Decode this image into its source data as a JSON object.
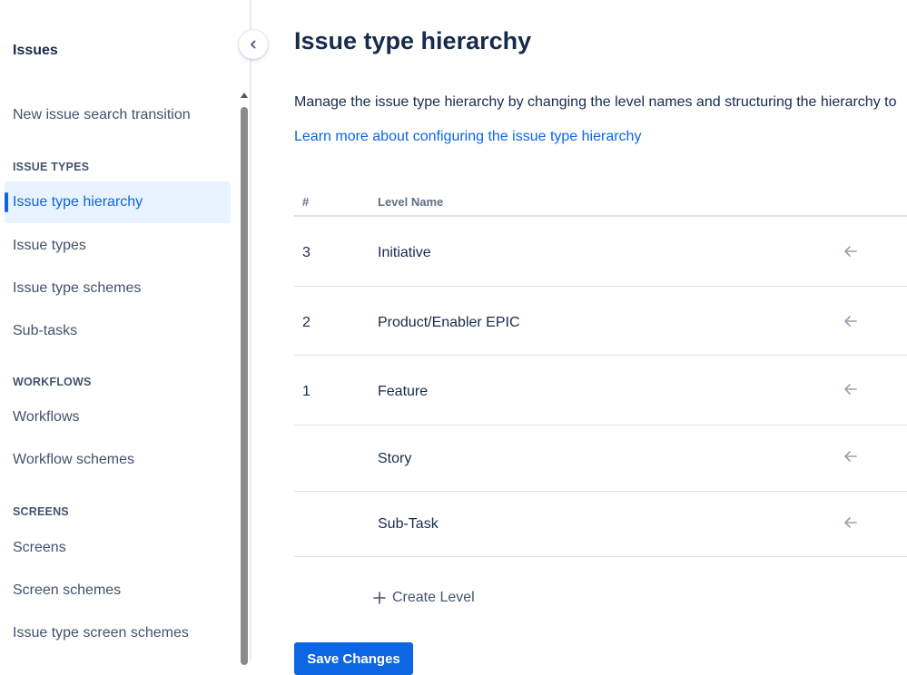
{
  "sidebar": {
    "title": "Issues",
    "top_item": "New issue search transition",
    "sections": [
      {
        "heading": "ISSUE TYPES",
        "items": [
          "Issue type hierarchy",
          "Issue types",
          "Issue type schemes",
          "Sub-tasks"
        ]
      },
      {
        "heading": "WORKFLOWS",
        "items": [
          "Workflows",
          "Workflow schemes"
        ]
      },
      {
        "heading": "SCREENS",
        "items": [
          "Screens",
          "Screen schemes",
          "Issue type screen schemes"
        ]
      }
    ],
    "active_item": "Issue type hierarchy"
  },
  "main": {
    "title": "Issue type hierarchy",
    "description": "Manage the issue type hierarchy by changing the level names and structuring the hierarchy to",
    "learn_more": "Learn more about configuring the issue type hierarchy",
    "table": {
      "headers": {
        "num": "#",
        "name": "Level Name"
      },
      "rows": [
        {
          "num": "3",
          "name": "Initiative"
        },
        {
          "num": "2",
          "name": "Product/Enabler EPIC"
        },
        {
          "num": "1",
          "name": "Feature"
        },
        {
          "num": "",
          "name": "Story"
        },
        {
          "num": "",
          "name": "Sub-Task"
        }
      ]
    },
    "create_level": "Create Level",
    "save_button": "Save Changes"
  },
  "colors": {
    "accent": "#0c66e4",
    "active_bg": "#e9f2ff",
    "text": "#172b4d",
    "muted": "#42526e"
  },
  "icons": {
    "collapse": "chevron-left-icon",
    "row_action": "arrow-left-icon",
    "create": "plus-icon"
  }
}
